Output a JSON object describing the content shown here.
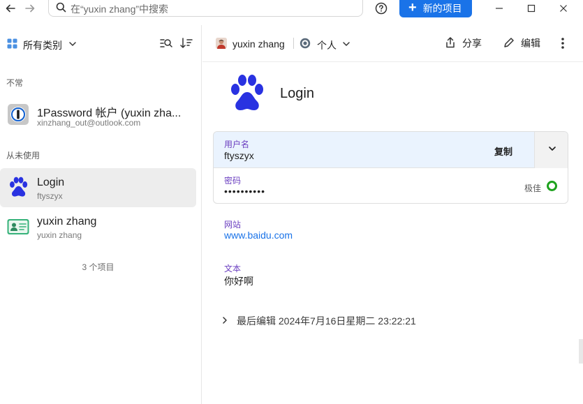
{
  "search": {
    "placeholder": "在“yuxin zhang”中搜索"
  },
  "toolbar": {
    "new_item_label": "新的项目"
  },
  "sidebar": {
    "category_label": "所有类别",
    "sections": [
      {
        "label": "不常"
      },
      {
        "label": "从未使用"
      }
    ],
    "items": [
      {
        "title": "1Password 帐户 (yuxin zha...",
        "subtitle": "xinzhang_out@outlook.com",
        "icon": "1password-icon"
      },
      {
        "title": "Login",
        "subtitle": "ftyszyx",
        "icon": "baidu-paw-icon"
      },
      {
        "title": "yuxin zhang",
        "subtitle": "yuxin zhang",
        "icon": "identity-card-icon"
      }
    ],
    "count_label": "3 个项目"
  },
  "detail": {
    "owner_name": "yuxin zhang",
    "vault_name": "个人",
    "share_label": "分享",
    "edit_label": "编辑",
    "title": "Login",
    "username_label": "用户名",
    "username_value": "ftyszyx",
    "copy_label": "复制",
    "password_label": "密码",
    "password_value": "••••••••••",
    "strength_label": "极佳",
    "website_label": "网站",
    "website_value": "www.baidu.com",
    "notes_label": "文本",
    "notes_value": "你好啊",
    "last_edited": "最后编辑 2024年7月16日星期二 23:22:21"
  },
  "colors": {
    "accent": "#1a73e8",
    "baidu_blue": "#2932e1",
    "field_label": "#6b3fc0",
    "strength_good": "#1ea21e",
    "selected_row": "#ededed",
    "username_row": "#eaf3fe"
  }
}
